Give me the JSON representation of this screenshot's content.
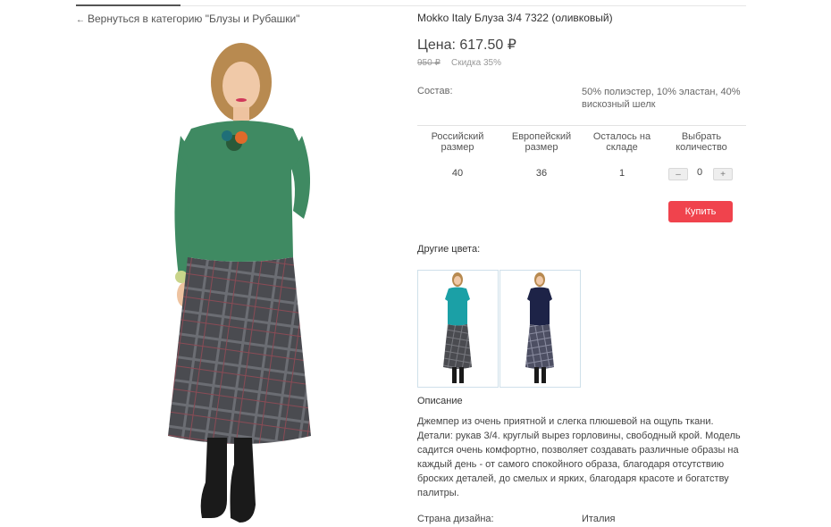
{
  "nav": {
    "back_link": "Вернуться в категорию \"Блузы и Рубашки\""
  },
  "product": {
    "title": "Mokko Italy Блуза 3/4 7322 (оливковый)",
    "price": "Цена: 617.50 ₽",
    "old_price": "950 ₽",
    "discount": "Скидка 35%",
    "composition_label": "Состав:",
    "composition_value": "50% полиэстер, 10% эластан, 40% вискозный шелк"
  },
  "size_table": {
    "headers": [
      "Российский размер",
      "Европейский размер",
      "Осталось на складе",
      "Выбрать количество"
    ],
    "row": {
      "ru_size": "40",
      "eu_size": "36",
      "stock": "1",
      "qty": "0"
    },
    "minus_label": "–",
    "plus_label": "+"
  },
  "buy_button": "Купить",
  "other_colors": {
    "label": "Другие цвета:"
  },
  "description": {
    "label": "Описание",
    "text": "Джемпер из очень приятной и слегка плюшевой на ощупь ткани. Детали: рукав 3/4. круглый вырез горловины, свободный крой. Модель садится очень комфортно, позволяет создавать различные образы на каждый день - от самого спокойного образа, благодаря отсутствию броских деталей, до смелых и ярких, благодаря красоте и богатству палитры."
  },
  "country": {
    "label": "Страна дизайна:",
    "value": "Италия"
  },
  "colors": {
    "accent": "#f0434d",
    "top_green": "#3f8a62",
    "top_teal": "#1ba0a6",
    "top_navy": "#1d2347",
    "skirt": "#4a4b50"
  }
}
